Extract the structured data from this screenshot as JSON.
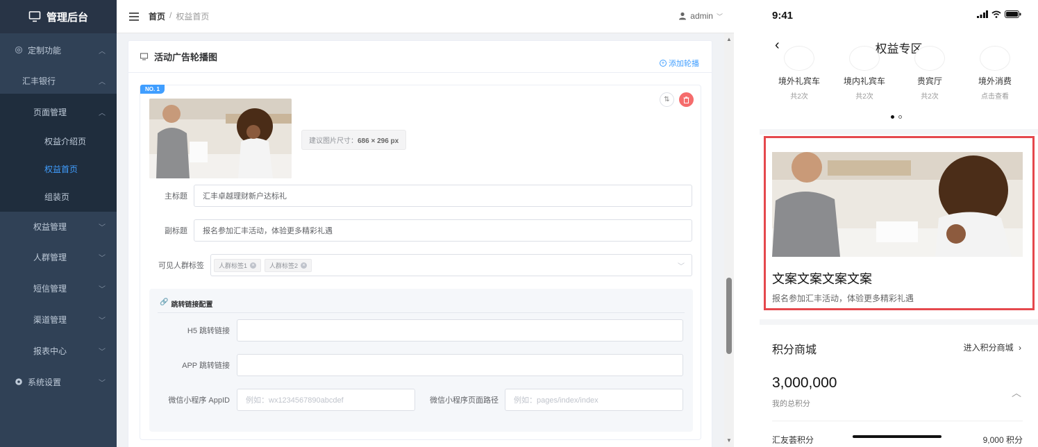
{
  "sidebar": {
    "brand": "管理后台",
    "items": [
      {
        "label": "定制功能"
      },
      {
        "label": "汇丰银行"
      },
      {
        "label": "页面管理"
      },
      {
        "label": "权益介绍页"
      },
      {
        "label": "权益首页"
      },
      {
        "label": "组装页"
      },
      {
        "label": "权益管理"
      },
      {
        "label": "人群管理"
      },
      {
        "label": "短信管理"
      },
      {
        "label": "渠道管理"
      },
      {
        "label": "报表中心"
      },
      {
        "label": "系统设置"
      }
    ]
  },
  "topbar": {
    "breadcrumb_home": "首页",
    "breadcrumb_sep": "/",
    "breadcrumb_current": "权益首页",
    "user": "admin"
  },
  "card": {
    "title": "活动广告轮播图",
    "add_label": "添加轮播",
    "item": {
      "badge": "NO. 1",
      "size_tip_prefix": "建议图片尺寸：",
      "size_tip_value": "686 × 296 px",
      "main_title_label": "主标题",
      "main_title_value": "汇丰卓越理财新户达标礼",
      "sub_title_label": "副标题",
      "sub_title_value": "报名参加汇丰活动，体验更多精彩礼遇",
      "tags_label": "可见人群标签",
      "tags": [
        "人群标签1",
        "人群标签2"
      ],
      "link_config": {
        "title": "跳转链接配置",
        "h5_label": "H5 跳转链接",
        "h5_value": "",
        "app_label": "APP 跳转链接",
        "app_value": "",
        "appid_label": "微信小程序 AppID",
        "appid_placeholder": "例如：wx1234567890abcdef",
        "path_label": "微信小程序页面路径",
        "path_placeholder": "例如：pages/index/index"
      }
    }
  },
  "phone": {
    "time": "9:41",
    "nav_title": "权益专区",
    "benefits": [
      {
        "name": "境外礼宾车",
        "sub": "共2次"
      },
      {
        "name": "境内礼宾车",
        "sub": "共2次"
      },
      {
        "name": "贵宾厅",
        "sub": "共2次"
      },
      {
        "name": "境外消费",
        "sub": "点击查看"
      }
    ],
    "banner_title": "文案文案文案文案",
    "banner_sub": "报名参加汇丰活动，体验更多精彩礼遇",
    "points_title": "积分商城",
    "points_link": "进入积分商城",
    "points_value": "3,000,000",
    "points_label": "我的总积分",
    "points_row_label": "汇友荟积分",
    "points_row_value": "9,000 积分"
  },
  "colors": {
    "sidebar_bg": "#304156",
    "accent": "#409eff",
    "danger": "#f56c6c",
    "highlight": "#e5484d"
  }
}
